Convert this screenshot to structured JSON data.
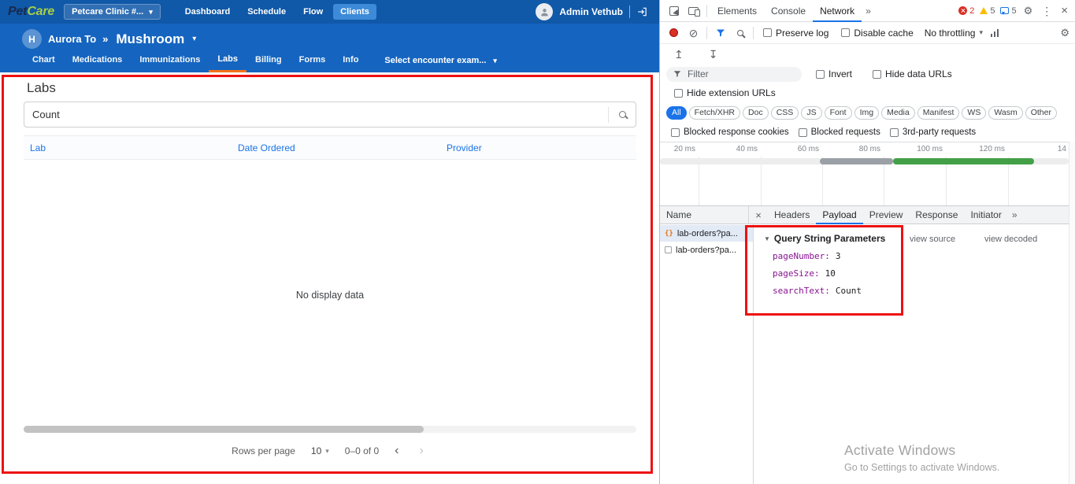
{
  "app": {
    "topbar": {
      "logo_pet": "Pet",
      "logo_care": "Care",
      "clinic_selector_label": "Petcare Clinic #...",
      "nav_items": [
        "Dashboard",
        "Schedule",
        "Flow",
        "Clients"
      ],
      "active_nav": "Clients",
      "user_name": "Admin Vethub"
    },
    "patient": {
      "avatar_letter": "H",
      "owner_name": "Aurora To",
      "separator": "»",
      "patient_name": "Mushroom",
      "tabs": [
        "Chart",
        "Medications",
        "Immunizations",
        "Labs",
        "Billing",
        "Forms",
        "Info"
      ],
      "active_tab": "Labs",
      "encounter_selector_label": "Select encounter exam..."
    },
    "labs_panel": {
      "title": "Labs",
      "search_value": "Count",
      "table_columns": [
        "Lab",
        "Date Ordered",
        "Provider"
      ],
      "empty_message": "No display data",
      "rows_per_page_label": "Rows per page",
      "rows_per_page_value": "10",
      "range_label": "0–0 of 0"
    }
  },
  "devtools": {
    "main_tabs": [
      "Elements",
      "Console",
      "Network"
    ],
    "active_main_tab": "Network",
    "error_count": "2",
    "warning_count": "5",
    "issue_count": "5",
    "toolbar": {
      "preserve_log_label": "Preserve log",
      "disable_cache_label": "Disable cache",
      "throttling_value": "No throttling"
    },
    "filter_bar": {
      "placeholder": "Filter",
      "invert_label": "Invert",
      "hide_data_urls_label": "Hide data URLs",
      "hide_extension_urls_label": "Hide extension URLs",
      "type_chips": [
        "All",
        "Fetch/XHR",
        "Doc",
        "CSS",
        "JS",
        "Font",
        "Img",
        "Media",
        "Manifest",
        "WS",
        "Wasm",
        "Other"
      ],
      "active_chip": "All",
      "blocked_cookies_label": "Blocked response cookies",
      "blocked_requests_label": "Blocked requests",
      "third_party_label": "3rd-party requests"
    },
    "timeline": {
      "ticks": [
        "20 ms",
        "40 ms",
        "60 ms",
        "80 ms",
        "100 ms",
        "120 ms",
        "14"
      ]
    },
    "network_table": {
      "name_header": "Name",
      "requests": [
        {
          "name": "lab-orders?pa...",
          "icon": "json-icon",
          "selected": true
        },
        {
          "name": "lab-orders?pa...",
          "icon": "doc-icon",
          "selected": false
        }
      ]
    },
    "detail_tabs": [
      "Headers",
      "Payload",
      "Preview",
      "Response",
      "Initiator"
    ],
    "active_detail_tab": "Payload",
    "payload": {
      "section_title": "Query String Parameters",
      "view_source_label": "view source",
      "view_decoded_label": "view decoded",
      "params": [
        {
          "name": "pageNumber",
          "value": "3"
        },
        {
          "name": "pageSize",
          "value": "10"
        },
        {
          "name": "searchText",
          "value": "Count"
        }
      ]
    }
  },
  "watermark": {
    "line1": "Activate Windows",
    "line2": "Go to Settings to activate Windows."
  },
  "icons": {
    "chevron_down": "▾",
    "double_angle": "»",
    "kebab": "⋮",
    "close": "×",
    "gear": "⚙",
    "clear": "⊘",
    "import_har": "↥",
    "export_har": "↧",
    "chevron_left": "‹",
    "chevron_right": "›",
    "disclosure_down": "▼",
    "json_braces": "{}"
  },
  "colors": {
    "topbar_blue": "#1058a8",
    "patientbar_blue": "#1565c0",
    "active_tab_orange": "#f4731c",
    "devtools_accent_blue": "#1a73e8",
    "annotation_red": "#ed1111",
    "param_name_purple": "#881391",
    "timeline_green": "#43a047",
    "timeline_gray": "#9aa0a6",
    "logo_green": "#a8cf45",
    "error_red": "#d93025",
    "warning_yellow": "#fbbc04"
  }
}
